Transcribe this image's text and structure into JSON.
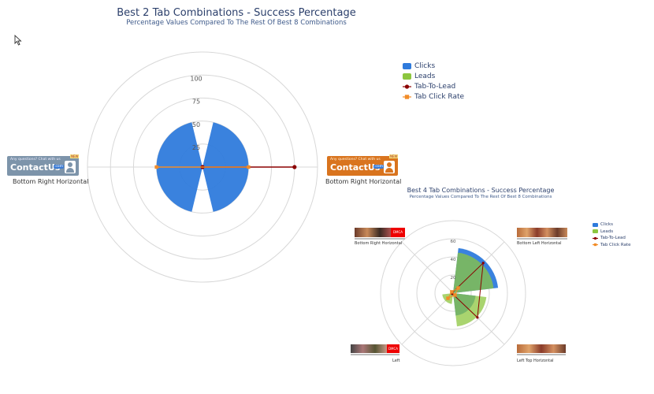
{
  "colors": {
    "clicks": "#2f7bdc",
    "leads": "#8cc63f",
    "tab_to_lead": "#8b0000",
    "tab_click_rate": "#f28c28",
    "grid": "#d8d8d8",
    "title": "#2b3f6b"
  },
  "chart_data": [
    {
      "type": "polar",
      "title": "Best 2 Tab Combinations - Success Percentage",
      "subtitle": "Percentage Values Compared To The Rest Of Best 8 Combinations",
      "radial_ticks": [
        "25",
        "50",
        "75",
        "100"
      ],
      "radial_max": 125,
      "categories": [
        "Bottom Right Horizontal",
        "Bottom Right Horizontal"
      ],
      "series": [
        {
          "name": "Clicks",
          "kind": "column",
          "values": [
            50,
            50
          ]
        },
        {
          "name": "Leads",
          "kind": "column",
          "values": [
            0,
            0
          ]
        },
        {
          "name": "Tab-To-Lead",
          "kind": "line",
          "values": [
            0,
            100
          ]
        },
        {
          "name": "Tab Click Rate",
          "kind": "line",
          "values": [
            50,
            50
          ]
        }
      ],
      "legend_position": "top-right"
    },
    {
      "type": "polar",
      "title": "Best 4 Tab Combinations - Success Percentage",
      "subtitle": "Percentage Values Compared To The Rest Of Best 8 Combinations",
      "radial_ticks": [
        "20",
        "40",
        "60"
      ],
      "radial_max": 80,
      "categories": [
        "Bottom Left Horizontal",
        "Left Top Horizontal",
        "Left",
        "Bottom Right Horizontal"
      ],
      "series": [
        {
          "name": "Clicks",
          "kind": "column",
          "values": [
            50,
            25,
            3,
            0
          ]
        },
        {
          "name": "Leads",
          "kind": "column",
          "values": [
            45,
            37,
            12,
            0
          ]
        },
        {
          "name": "Tab-To-Lead",
          "kind": "line",
          "values": [
            47,
            38,
            1,
            1
          ]
        },
        {
          "name": "Tab Click Rate",
          "kind": "line",
          "values": [
            8,
            3,
            8,
            2
          ]
        }
      ],
      "legend_position": "top-right"
    }
  ],
  "badges": {
    "question": "Any questions? Chat with us",
    "brand": "ContactUs",
    "suffix": ".com",
    "tag": "NEW"
  },
  "thumb_tag": "DMCA"
}
